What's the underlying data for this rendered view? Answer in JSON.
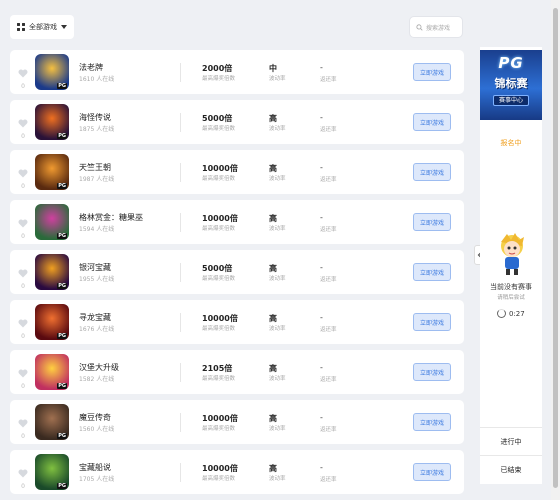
{
  "toolbar": {
    "filter_label": "全部游戏",
    "search_placeholder": "搜索游戏"
  },
  "columns": {
    "online_suffix": "人在线",
    "multiplier_label": "最高爆奖倍数",
    "rate_label": "波动率",
    "return_label": "返还率",
    "play_label": "立即游戏",
    "return_value": "-"
  },
  "games": [
    {
      "name": "法老牌",
      "online": "1610",
      "likes": "0",
      "multiplier": "2000倍",
      "volatility": "中",
      "thumb": [
        "#1b3a8a",
        "#f5c040"
      ]
    },
    {
      "name": "海怪传说",
      "online": "1875",
      "likes": "0",
      "multiplier": "5000倍",
      "volatility": "高",
      "thumb": [
        "#2a1238",
        "#f07020"
      ]
    },
    {
      "name": "天竺王朝",
      "online": "1987",
      "likes": "0",
      "multiplier": "10000倍",
      "volatility": "高",
      "thumb": [
        "#5a2a10",
        "#f09a30"
      ]
    },
    {
      "name": "格林赏金：糖果巫",
      "online": "1594",
      "likes": "0",
      "multiplier": "10000倍",
      "volatility": "高",
      "thumb": [
        "#2a6a3a",
        "#d040a0"
      ]
    },
    {
      "name": "银河宝藏",
      "online": "1955",
      "likes": "0",
      "multiplier": "5000倍",
      "volatility": "高",
      "thumb": [
        "#2a0a40",
        "#f0a020"
      ]
    },
    {
      "name": "寻龙宝藏",
      "online": "1676",
      "likes": "0",
      "multiplier": "10000倍",
      "volatility": "高",
      "thumb": [
        "#5a0a10",
        "#f07030"
      ]
    },
    {
      "name": "汉堡大升级",
      "online": "1582",
      "likes": "0",
      "multiplier": "2105倍",
      "volatility": "高",
      "thumb": [
        "#c03060",
        "#ffd040"
      ]
    },
    {
      "name": "魔豆传奇",
      "online": "1560",
      "likes": "0",
      "multiplier": "10000倍",
      "volatility": "高",
      "thumb": [
        "#3a2a20",
        "#a07050"
      ]
    },
    {
      "name": "宝藏船说",
      "online": "1705",
      "likes": "0",
      "multiplier": "10000倍",
      "volatility": "高",
      "thumb": [
        "#1a4a2a",
        "#80c040"
      ]
    }
  ],
  "thumb_badge": "PG",
  "sidebar": {
    "banner_logo": "PG",
    "banner_title": "锦标赛",
    "banner_sub": "赛事中心",
    "register_label": "报名中",
    "empty_title": "当前没有赛事",
    "empty_sub": "请稍后尝试",
    "timer": "0:27",
    "tab_ongoing": "进行中",
    "tab_ended": "已结束"
  }
}
